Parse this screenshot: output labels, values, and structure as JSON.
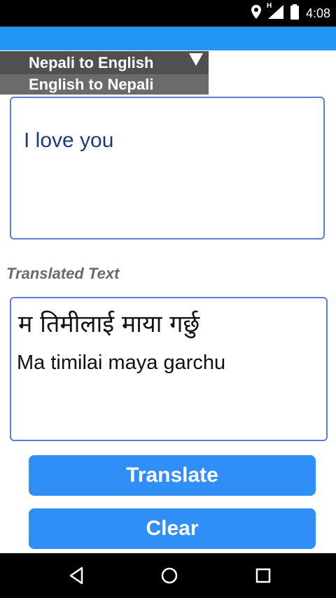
{
  "status_bar": {
    "time": "4:08",
    "network_label": "H"
  },
  "language_dropdown": {
    "selected": "Nepali to English",
    "options": [
      "English to Nepali"
    ]
  },
  "input": {
    "text": "I love you"
  },
  "output": {
    "label": "Translated Text",
    "nepali_text": "म तिमीलाई माया गर्छु",
    "romanized_text": "Ma timilai maya garchu"
  },
  "buttons": {
    "translate": "Translate",
    "clear": "Clear"
  },
  "colors": {
    "app_bar": "#2196f3",
    "button": "#2f8ff7",
    "box_border": "#5b7ed6",
    "dropdown_selected": "#505050",
    "dropdown_option": "#6b6b6b"
  }
}
